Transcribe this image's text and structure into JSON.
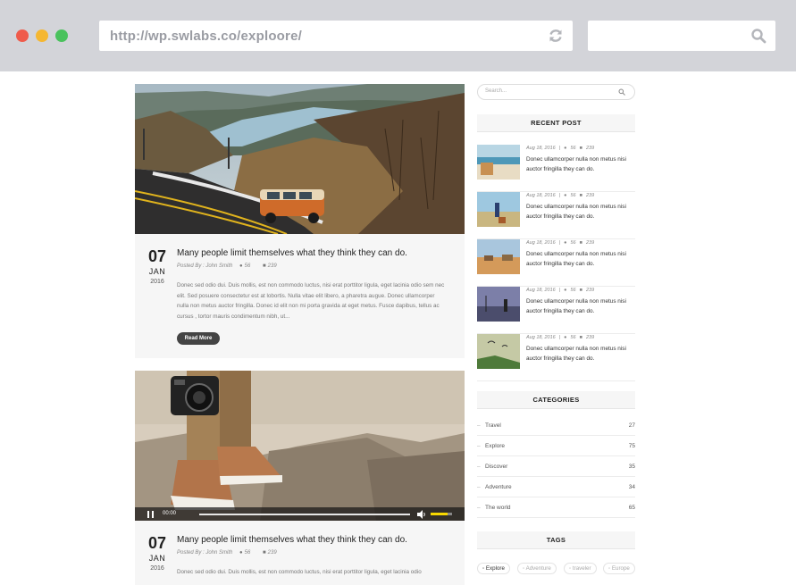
{
  "browser": {
    "url": "http://wp.swlabs.co/exploore/"
  },
  "posts": [
    {
      "day": "07",
      "month": "JAN",
      "year": "2016",
      "title": "Many people limit themselves what they think they can do.",
      "author": "Posted By : John Smith",
      "likes": "56",
      "comments": "239",
      "excerpt": "Donec sed odio dui. Duis mollis, est non commodo luctus, nisi erat porttitor ligula, eget lacinia odio sem nec elit. Sed posuere consectetur est at lobortis. Nulla vitae elit libero, a pharetra augue. Donec ullamcorper nulla non metus auctor fringilla. Donec id elit non mi porta gravida at eget metus. Fusce dapibus, tellus ac cursus , tortor mauris condimentum nibh, ut...",
      "read_more": "Read More"
    },
    {
      "day": "07",
      "month": "JAN",
      "year": "2016",
      "title": "Many people limit themselves what they think they can do.",
      "author": "Posted By : John Smith",
      "likes": "56",
      "comments": "239",
      "excerpt": "Donec sed odio dui. Duis mollis, est non commodo luctus, nisi erat porttitor ligula, eget lacinia odio"
    }
  ],
  "video": {
    "time": "00:00",
    "volume": 0.8
  },
  "sidebar": {
    "search_placeholder": "Search...",
    "recent_title": "RECENT POST",
    "recent_posts": [
      {
        "date": "Aug 18, 2016",
        "likes": "56",
        "comments": "239",
        "text": "Donec ullamcorper nulla non metus nisi auctor fringilla they can do."
      },
      {
        "date": "Aug 18, 2016",
        "likes": "56",
        "comments": "239",
        "text": "Donec ullamcorper nulla non metus nisi auctor fringilla they can do."
      },
      {
        "date": "Aug 18, 2016",
        "likes": "56",
        "comments": "239",
        "text": "Donec ullamcorper nulla non metus nisi auctor fringilla they can do."
      },
      {
        "date": "Aug 18, 2016",
        "likes": "56",
        "comments": "239",
        "text": "Donec ullamcorper nulla non metus nisi auctor fringilla they can do."
      },
      {
        "date": "Aug 18, 2016",
        "likes": "56",
        "comments": "239",
        "text": "Donec ullamcorper nulla non metus nisi auctor fringilla they can do."
      }
    ],
    "categories_title": "CATEGORIES",
    "categories": [
      {
        "name": "Travel",
        "count": "27"
      },
      {
        "name": "Explore",
        "count": "75"
      },
      {
        "name": "Discover",
        "count": "35"
      },
      {
        "name": "Adventure",
        "count": "34"
      },
      {
        "name": "The world",
        "count": "65"
      }
    ],
    "tags_title": "TAGS",
    "tags": [
      "Explore",
      "Adventure",
      "traveler",
      "Europe"
    ]
  }
}
